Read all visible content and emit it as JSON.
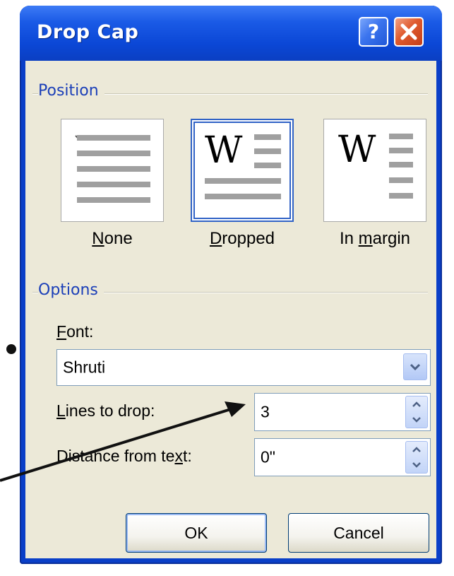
{
  "window": {
    "title": "Drop Cap",
    "help_label": "?",
    "close_icon": "close-x-icon"
  },
  "position": {
    "group_label": "Position",
    "options": [
      {
        "label": "None",
        "mnemonic": "N",
        "rest": "one",
        "selected": false
      },
      {
        "label": "Dropped",
        "mnemonic": "D",
        "rest": "ropped",
        "selected": true
      },
      {
        "label": "In margin",
        "prefix": "In ",
        "mnemonic": "m",
        "rest": "argin",
        "selected": false
      }
    ],
    "preview_letter": "W"
  },
  "options": {
    "group_label": "Options",
    "font_label": "Font:",
    "font_label_mnemonic": "F",
    "font_label_rest": "ont:",
    "font_value": "Shruti",
    "lines_label_mnemonic": "L",
    "lines_label_rest": "ines to drop:",
    "lines_value": "3",
    "distance_label_pre": "Distance from te",
    "distance_label_mnemonic": "x",
    "distance_label_post": "t:",
    "distance_value": "0\""
  },
  "buttons": {
    "ok_label": "OK",
    "cancel_label": "Cancel"
  },
  "colors": {
    "titlebar": "#0b47d6",
    "group_label": "#1b3fb8",
    "client_bg": "#ece9d8",
    "selection_border": "#3163c6"
  }
}
